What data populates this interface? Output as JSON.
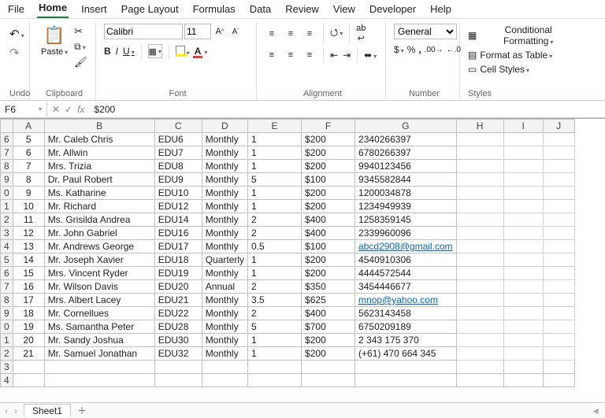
{
  "tabs": [
    "File",
    "Home",
    "Insert",
    "Page Layout",
    "Formulas",
    "Data",
    "Review",
    "View",
    "Developer",
    "Help"
  ],
  "active_tab": "Home",
  "groups": {
    "undo": "Undo",
    "clipboard": "Clipboard",
    "font": "Font",
    "alignment": "Alignment",
    "number": "Number",
    "styles": "Styles"
  },
  "clipboard": {
    "paste": "Paste"
  },
  "font": {
    "name": "Calibri",
    "size": "11"
  },
  "number": {
    "format": "General"
  },
  "styles": {
    "cond": "Conditional Formatting",
    "table": "Format as Table",
    "cell": "Cell Styles"
  },
  "namebox": "F6",
  "formula": "$200",
  "fx": "fx",
  "cols": [
    "A",
    "B",
    "C",
    "D",
    "E",
    "F",
    "G",
    "H",
    "I",
    "J"
  ],
  "row_headers": [
    "6",
    "7",
    "8",
    "9",
    "0",
    "1",
    "2",
    "3",
    "4",
    "5",
    "6",
    "7",
    "8",
    "9",
    "0",
    "1",
    "2",
    "3",
    "4"
  ],
  "data": [
    {
      "a": "5",
      "b": "Mr. Caleb Chris",
      "c": "EDU6",
      "d": "Monthly",
      "e": "1",
      "f": "$200",
      "g": "2340266397",
      "link": false
    },
    {
      "a": "6",
      "b": "Mr. Allwin",
      "c": "EDU7",
      "d": "Monthly",
      "e": "1",
      "f": "$200",
      "g": "6780266397",
      "link": false
    },
    {
      "a": "7",
      "b": "Mrs. Trizia",
      "c": "EDU8",
      "d": "Monthly",
      "e": "1",
      "f": "$200",
      "g": "9940123456",
      "link": false
    },
    {
      "a": "8",
      "b": "Dr. Paul Robert",
      "c": "EDU9",
      "d": "Monthly",
      "e": "5",
      "f": "$100",
      "g": "9345582844",
      "link": false
    },
    {
      "a": "9",
      "b": "Ms. Katharine",
      "c": "EDU10",
      "d": "Monthly",
      "e": "1",
      "f": "$200",
      "g": "1200034878",
      "link": false
    },
    {
      "a": "10",
      "b": "Mr. Richard",
      "c": "EDU12",
      "d": "Monthly",
      "e": "1",
      "f": "$200",
      "g": "1234949939",
      "link": false
    },
    {
      "a": "11",
      "b": "Ms. Grisilda Andrea",
      "c": "EDU14",
      "d": "Monthly",
      "e": "2",
      "f": "$400",
      "g": "1258359145",
      "link": false
    },
    {
      "a": "12",
      "b": "Mr. John Gabriel",
      "c": "EDU16",
      "d": "Monthly",
      "e": "2",
      "f": "$400",
      "g": "2339960096",
      "link": false
    },
    {
      "a": "13",
      "b": "Mr. Andrews George",
      "c": "EDU17",
      "d": "Monthly",
      "e": "0.5",
      "f": "$100",
      "g": "abcd2908@gmail.com",
      "link": true
    },
    {
      "a": "14",
      "b": "Mr. Joseph Xavier",
      "c": "EDU18",
      "d": "Quarterly",
      "e": "1",
      "f": "$200",
      "g": "4540910306",
      "link": false
    },
    {
      "a": "15",
      "b": "Mrs. Vincent Ryder",
      "c": "EDU19",
      "d": "Monthly",
      "e": "1",
      "f": "$200",
      "g": "4444572544",
      "link": false
    },
    {
      "a": "16",
      "b": "Mr. Wilson Davis",
      "c": "EDU20",
      "d": "Annual",
      "e": "2",
      "f": "$350",
      "g": "3454446677",
      "link": false
    },
    {
      "a": "17",
      "b": "Mrs. Albert Lacey",
      "c": "EDU21",
      "d": "Monthly",
      "e": "3.5",
      "f": "$625",
      "g": "mnop@yahoo.com",
      "link": true
    },
    {
      "a": "18",
      "b": "Mr. Cornellues",
      "c": "EDU22",
      "d": "Monthly",
      "e": "2",
      "f": "$400",
      "g": "5623143458",
      "link": false
    },
    {
      "a": "19",
      "b": "Ms. Samantha Peter",
      "c": "EDU28",
      "d": "Monthly",
      "e": "5",
      "f": "$700",
      "g": "6750209189",
      "link": false
    },
    {
      "a": "20",
      "b": "Mr. Sandy Joshua",
      "c": "EDU30",
      "d": "Monthly",
      "e": "1",
      "f": "$200",
      "g": "2 343 175 370",
      "link": false
    },
    {
      "a": "21",
      "b": "Mr. Samuel Jonathan",
      "c": "EDU32",
      "d": "Monthly",
      "e": "1",
      "f": "$200",
      "g": "(+61) 470 664 345",
      "link": false
    }
  ],
  "sheet": "Sheet1"
}
